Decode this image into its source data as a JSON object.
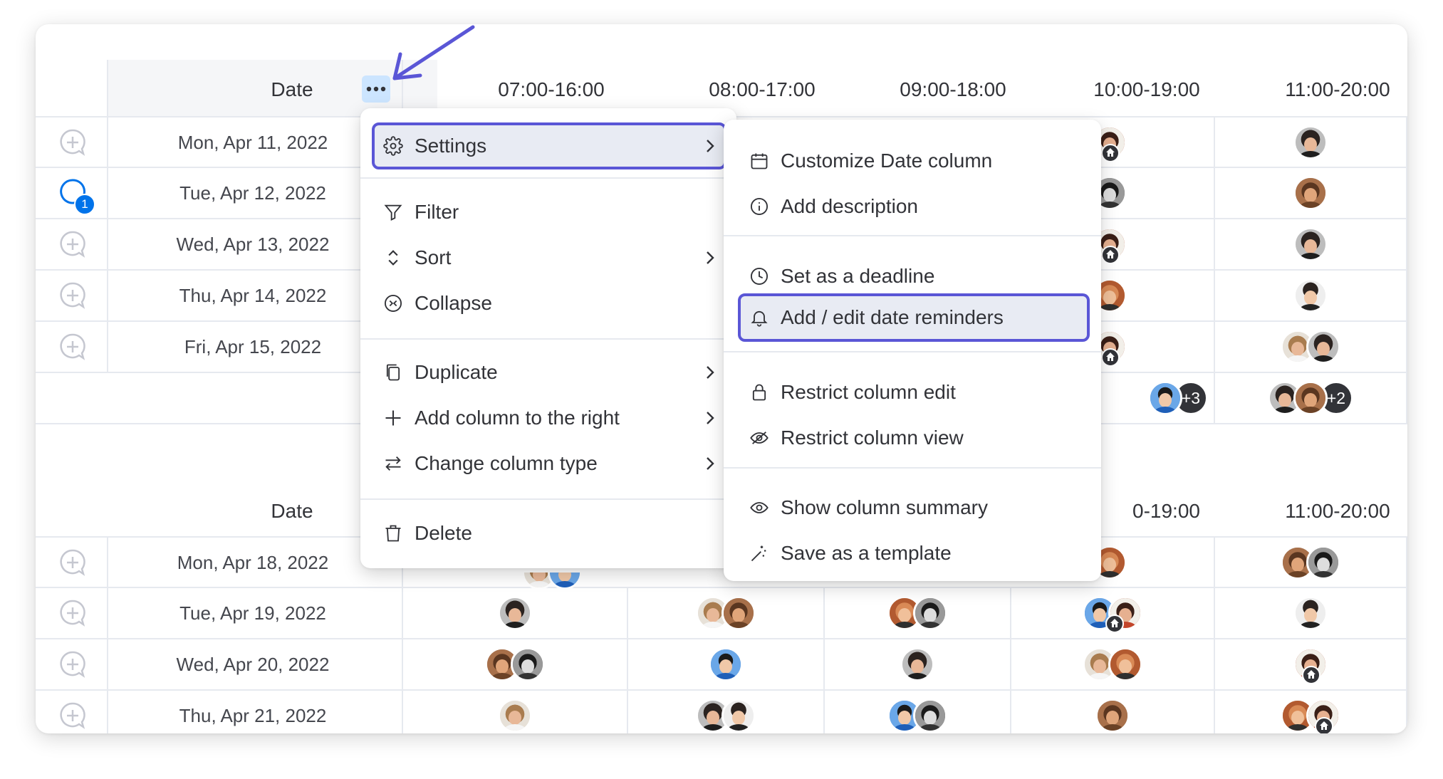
{
  "table": {
    "date_header": "Date",
    "time_headers": [
      "07:00-16:00",
      "08:00-17:00",
      "09:00-18:00",
      "10:00-19:00",
      "11:00-20:00"
    ],
    "group1_dates": [
      "Mon, Apr 11, 2022",
      "Tue, Apr 12, 2022",
      "Wed, Apr 13, 2022",
      "Thu, Apr 14, 2022",
      "Fri, Apr 15, 2022"
    ],
    "group2_dates": [
      "Mon, Apr 18, 2022",
      "Tue, Apr 19, 2022",
      "Wed, Apr 20, 2022",
      "Thu, Apr 21, 2022"
    ],
    "group2_partial_header": "0-19:00",
    "update_badge": "1",
    "summary_more_1": "+3",
    "summary_more_2": "+2"
  },
  "menu": {
    "items": [
      {
        "label": "Settings",
        "icon": "gear-icon",
        "submenu": true
      },
      {
        "label": "Filter",
        "icon": "filter-icon",
        "submenu": false
      },
      {
        "label": "Sort",
        "icon": "sort-icon",
        "submenu": true
      },
      {
        "label": "Collapse",
        "icon": "collapse-icon",
        "submenu": false
      },
      {
        "label": "Duplicate",
        "icon": "duplicate-icon",
        "submenu": true
      },
      {
        "label": "Add column to the right",
        "icon": "plus-icon",
        "submenu": true
      },
      {
        "label": "Change column type",
        "icon": "swap-icon",
        "submenu": true
      },
      {
        "label": "Delete",
        "icon": "trash-icon",
        "submenu": false
      }
    ]
  },
  "submenu": {
    "items": [
      {
        "label": "Customize Date column",
        "icon": "calendar-icon"
      },
      {
        "label": "Add description",
        "icon": "info-icon"
      },
      {
        "label": "Set as a deadline",
        "icon": "clock-icon"
      },
      {
        "label": "Add / edit date reminders",
        "icon": "bell-icon"
      },
      {
        "label": "Restrict column edit",
        "icon": "lock-icon"
      },
      {
        "label": "Restrict column view",
        "icon": "eye-off-icon"
      },
      {
        "label": "Show column summary",
        "icon": "eye-icon"
      },
      {
        "label": "Save as a template",
        "icon": "magic-wand-icon"
      }
    ]
  },
  "colors": {
    "accent": "#5a56d6",
    "highlight_bg": "#e8ebf3",
    "grid": "#e6e9ef",
    "badge_blue": "#0073ea",
    "text": "#323338"
  }
}
